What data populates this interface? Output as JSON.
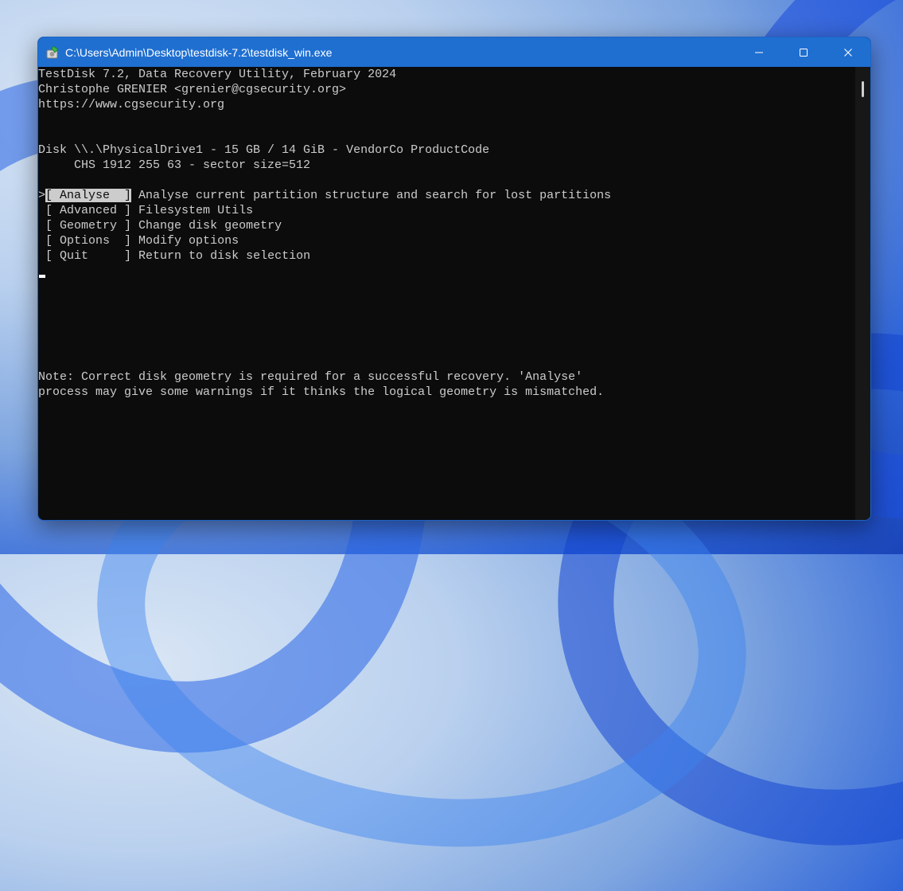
{
  "window": {
    "title": "C:\\Users\\Admin\\Desktop\\testdisk-7.2\\testdisk_win.exe",
    "app_icon": "testdisk-app-icon",
    "buttons": {
      "minimize": "minimize-icon",
      "maximize": "maximize-icon",
      "close": "close-icon"
    }
  },
  "console": {
    "header": [
      "TestDisk 7.2, Data Recovery Utility, February 2024",
      "Christophe GRENIER <grenier@cgsecurity.org>",
      "https://www.cgsecurity.org"
    ],
    "disk_line": "Disk \\\\.\\PhysicalDrive1 - 15 GB / 14 GiB - VendorCo ProductCode",
    "chs_line": "     CHS 1912 255 63 - sector size=512",
    "menu": [
      {
        "prefix": ">",
        "label": "[ Analyse  ]",
        "description": " Analyse current partition structure and search for lost partitions",
        "selected": true
      },
      {
        "prefix": " ",
        "label": "[ Advanced ]",
        "description": " Filesystem Utils",
        "selected": false
      },
      {
        "prefix": " ",
        "label": "[ Geometry ]",
        "description": " Change disk geometry",
        "selected": false
      },
      {
        "prefix": " ",
        "label": "[ Options  ]",
        "description": " Modify options",
        "selected": false
      },
      {
        "prefix": " ",
        "label": "[ Quit     ]",
        "description": " Return to disk selection",
        "selected": false
      }
    ],
    "note": [
      "Note: Correct disk geometry is required for a successful recovery. 'Analyse'",
      "process may give some warnings if it thinks the logical geometry is mismatched."
    ]
  },
  "colors": {
    "titlebar": "#1f6fd1",
    "console_bg": "#0c0c0c",
    "console_text": "#cccccc",
    "selection_bg": "#cccccc"
  }
}
